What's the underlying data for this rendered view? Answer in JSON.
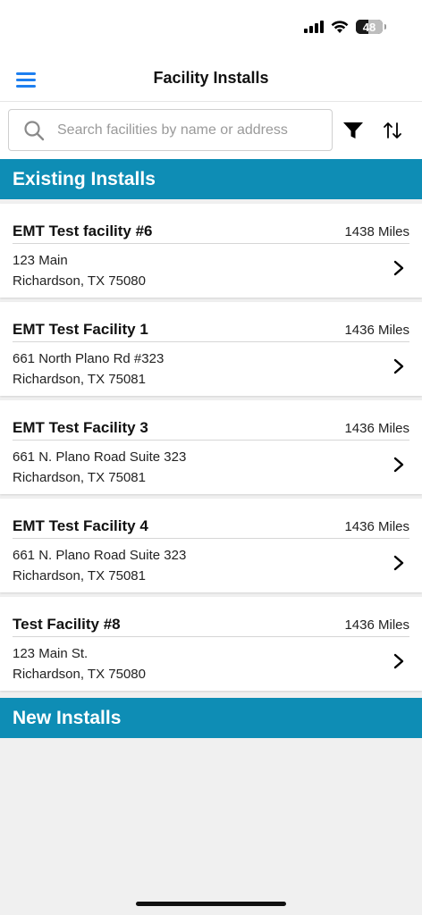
{
  "status": {
    "battery": "48"
  },
  "header": {
    "title": "Facility Installs"
  },
  "search": {
    "placeholder": "Search facilities by name or address",
    "value": ""
  },
  "sections": {
    "existing_title": "Existing Installs",
    "new_title": "New Installs"
  },
  "facilities": [
    {
      "name": "EMT Test facility #6",
      "distance": "1438 Miles",
      "address_line1": "123 Main",
      "address_line2": "Richardson, TX 75080"
    },
    {
      "name": "EMT Test Facility 1",
      "distance": "1436 Miles",
      "address_line1": "661 North Plano Rd #323",
      "address_line2": "Richardson, TX 75081"
    },
    {
      "name": "EMT Test Facility 3",
      "distance": "1436 Miles",
      "address_line1": "661 N. Plano Road Suite 323",
      "address_line2": "Richardson, TX 75081"
    },
    {
      "name": "EMT Test Facility 4",
      "distance": "1436 Miles",
      "address_line1": "661 N. Plano Road Suite 323",
      "address_line2": "Richardson, TX 75081"
    },
    {
      "name": "Test Facility #8",
      "distance": "1436 Miles",
      "address_line1": "123 Main St.",
      "address_line2": "Richardson, TX 75080"
    }
  ],
  "colors": {
    "accent": "#1d7ff0",
    "section": "#0e8db5",
    "background": "#f0f0f0"
  }
}
